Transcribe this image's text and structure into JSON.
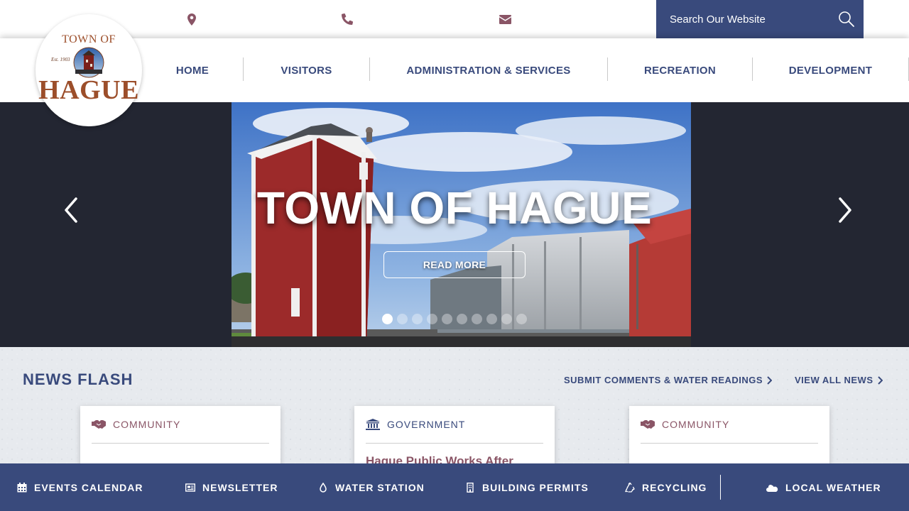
{
  "colors": {
    "brand_navy": "#394a7c",
    "accent_mauve": "#8a5566",
    "hero_bg": "#232632"
  },
  "header": {
    "icons": [
      "location-pin-icon",
      "phone-icon",
      "envelope-icon"
    ],
    "search": {
      "placeholder": "Search Our Website",
      "icon": "search-icon"
    }
  },
  "logo": {
    "line1": "TOWN OF",
    "est": "Est. 1903",
    "line2": "HAGUE"
  },
  "nav": {
    "items": [
      {
        "label": "HOME"
      },
      {
        "label": "VISITORS"
      },
      {
        "label": "ADMINISTRATION & SERVICES"
      },
      {
        "label": "RECREATION"
      },
      {
        "label": "DEVELOPMENT"
      }
    ]
  },
  "hero": {
    "title": "TOWN OF HAGUE",
    "button": "READ MORE",
    "slide_count": 10,
    "active_slide": 1
  },
  "news": {
    "heading": "NEWS FLASH",
    "links": [
      {
        "label": "SUBMIT COMMENTS & WATER READINGS"
      },
      {
        "label": "VIEW ALL NEWS"
      }
    ],
    "cards": [
      {
        "category": "COMMUNITY",
        "category_icon": "handshake-icon",
        "title": ""
      },
      {
        "category": "GOVERNMENT",
        "category_icon": "government-building-icon",
        "title": "Hague Public Works After"
      },
      {
        "category": "COMMUNITY",
        "category_icon": "handshake-icon",
        "title": ""
      }
    ]
  },
  "quick_links": [
    {
      "label": "EVENTS CALENDAR",
      "icon": "calendar-icon"
    },
    {
      "label": "NEWSLETTER",
      "icon": "newspaper-icon"
    },
    {
      "label": "WATER STATION",
      "icon": "water-drop-icon"
    },
    {
      "label": "BUILDING PERMITS",
      "icon": "building-icon"
    },
    {
      "label": "RECYCLING",
      "icon": "recycle-icon"
    },
    {
      "label": "LOCAL WEATHER",
      "icon": "weather-icon"
    }
  ]
}
